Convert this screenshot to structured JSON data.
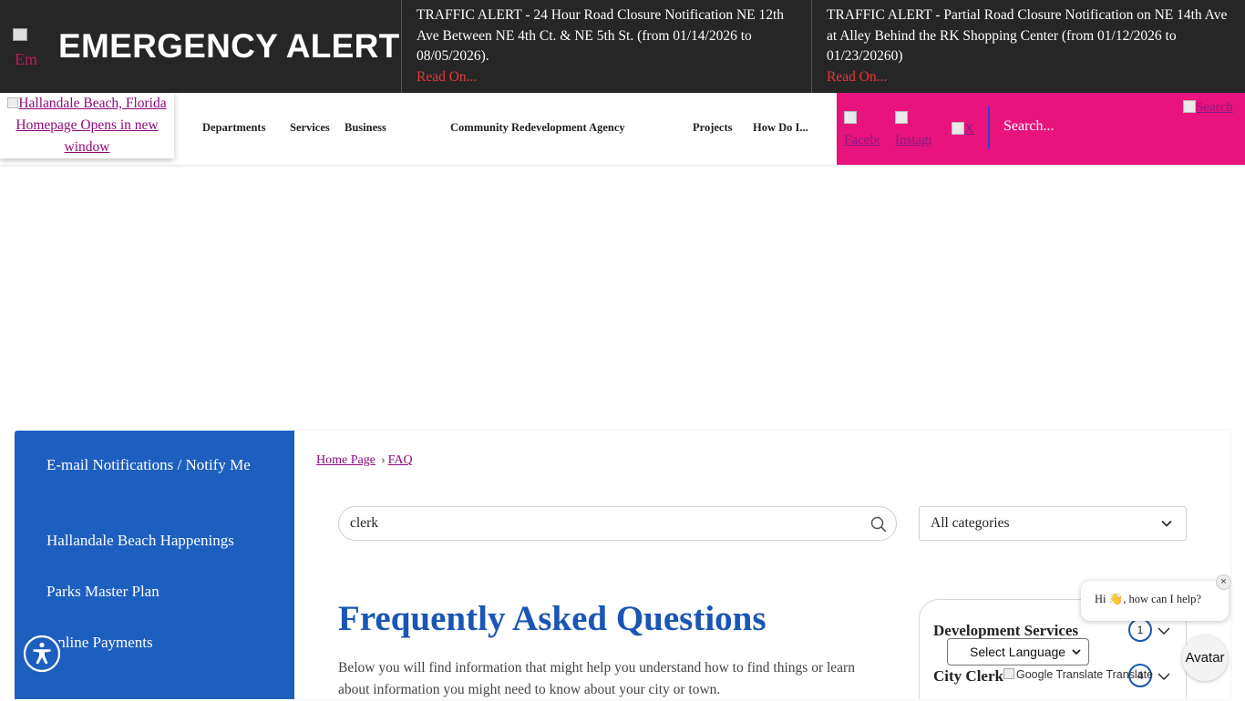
{
  "emergency": {
    "logo_alt": "Em",
    "title": "EMERGENCY ALERT",
    "alerts": [
      {
        "text": "TRAFFIC ALERT - 24 Hour Road Closure Notification NE 12th Ave Between NE 4th Ct. & NE 5th St. (from 01/14/2026 to 08/05/2026).",
        "link": "Read On..."
      },
      {
        "text": "TRAFFIC ALERT - Partial Road Closure Notification on NE 14th Ave at Alley Behind the RK Shopping Center (from 01/12/2026 to 01/23/20260)",
        "link": "Read On..."
      }
    ]
  },
  "header": {
    "logo_alt": "Hallandale Beach, Florida Homepage Opens in new window",
    "nav": [
      "Departments",
      "Services",
      "Business",
      "Community Redevelopment Agency",
      "Projects",
      "How Do I..."
    ],
    "social": [
      "Facebook",
      "Instagram",
      "X"
    ],
    "search_placeholder": "Search...",
    "search_button_alt": "Search",
    "accent_color": "#e8137c"
  },
  "sidebar": {
    "items": [
      "E-mail Notifications / Notify Me",
      "Hallandale Beach Happenings",
      "Parks Master Plan",
      "Online Payments"
    ]
  },
  "breadcrumb": [
    "Home Page",
    "FAQ"
  ],
  "faq_search": {
    "value": "clerk"
  },
  "category_filter": {
    "selected": "All categories"
  },
  "faq": {
    "title": "Frequently Asked Questions",
    "description": "Below you will find information that might help you understand how to find things or learn about information you might need to know about your city or town."
  },
  "categories": [
    {
      "name": "Development Services",
      "count": "1"
    },
    {
      "name": "City Clerk",
      "count": "4"
    }
  ],
  "translate": {
    "select_label": "Select Language",
    "credit": "Google Translate Translate"
  },
  "chat": {
    "greeting": "Hi 👋, how can I help?",
    "close": "×",
    "avatar_label": "Avatar"
  }
}
